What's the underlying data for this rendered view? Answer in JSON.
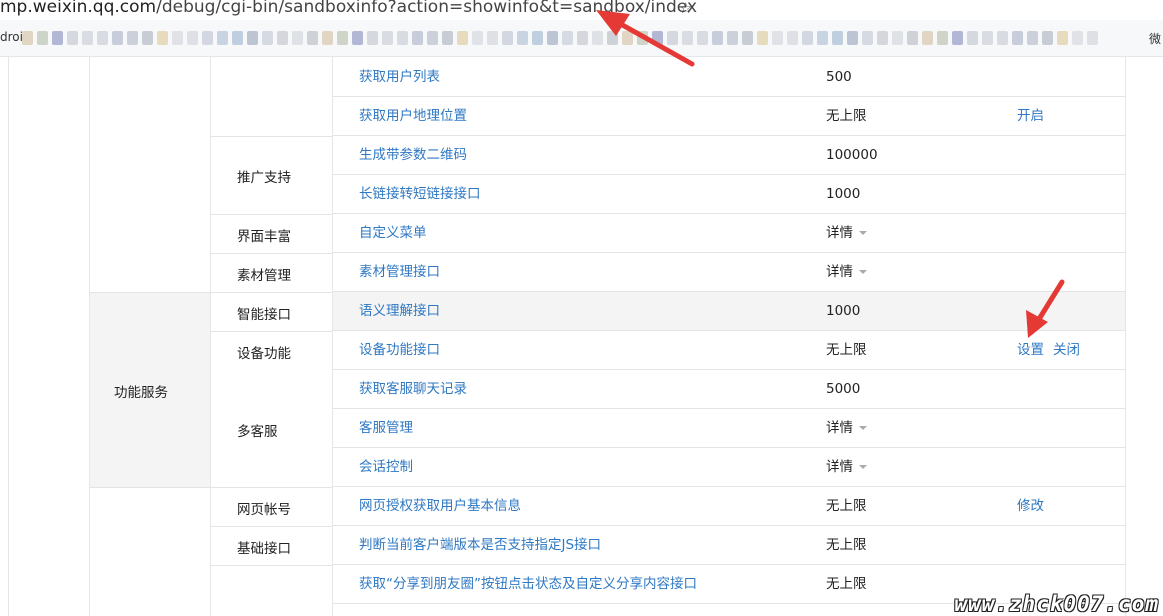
{
  "address_bar": {
    "host": "mp.weixin.qq.com",
    "path": "/debug/cgi-bin/sandboxinfo?action=showinfo&t=sandbox/index"
  },
  "bookmarks": {
    "left_label": "droi",
    "right_label": "微"
  },
  "colors": {
    "link": "#2f78c3",
    "arrow": "#e53935",
    "grid": "#e4e4e4",
    "highlight_bg": "#f4f4f4"
  },
  "category": "功能服务",
  "groups": [
    "推广支持",
    "界面丰富",
    "素材管理",
    "智能接口",
    "设备功能",
    "多客服",
    "网页帐号",
    "基础接口"
  ],
  "rows": [
    {
      "api": "获取用户列表",
      "limit": "500",
      "ops": []
    },
    {
      "api": "获取用户地理位置",
      "limit": "无上限",
      "ops": [
        "开启"
      ]
    },
    {
      "api": "生成带参数二维码",
      "limit": "100000",
      "ops": []
    },
    {
      "api": "长链接转短链接接口",
      "limit": "1000",
      "ops": []
    },
    {
      "api": "自定义菜单",
      "limit": "详情",
      "ops": []
    },
    {
      "api": "素材管理接口",
      "limit": "详情",
      "ops": []
    },
    {
      "api": "语义理解接口",
      "limit": "1000",
      "ops": []
    },
    {
      "api": "设备功能接口",
      "limit": "无上限",
      "ops": [
        "设置",
        "关闭"
      ]
    },
    {
      "api": "获取客服聊天记录",
      "limit": "5000",
      "ops": []
    },
    {
      "api": "客服管理",
      "limit": "详情",
      "ops": []
    },
    {
      "api": "会话控制",
      "limit": "详情",
      "ops": []
    },
    {
      "api": "网页授权获取用户基本信息",
      "limit": "无上限",
      "ops": [
        "修改"
      ]
    },
    {
      "api": "判断当前客户端版本是否支持指定JS接口",
      "limit": "无上限",
      "ops": []
    },
    {
      "api": "获取“分享到朋友圈”按钮点击状态及自定义分享内容接口",
      "limit": "无上限",
      "ops": []
    }
  ],
  "watermark": "www.zhck007.com"
}
